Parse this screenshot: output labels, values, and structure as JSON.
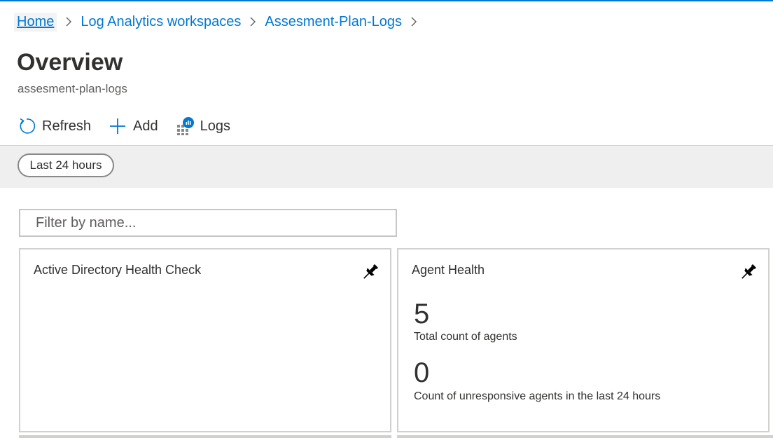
{
  "breadcrumb": {
    "items": [
      "Home",
      "Log Analytics workspaces",
      "Assesment-Plan-Logs"
    ]
  },
  "page": {
    "title": "Overview",
    "subtitle": "assesment-plan-logs"
  },
  "toolbar": {
    "refresh_label": "Refresh",
    "add_label": "Add",
    "logs_label": "Logs"
  },
  "time_filter": {
    "label": "Last 24 hours"
  },
  "filter": {
    "placeholder": "Filter by name..."
  },
  "tiles": {
    "ad_health": {
      "title": "Active Directory Health Check"
    },
    "agent_health": {
      "title": "Agent Health",
      "total_count": "5",
      "total_label": "Total count of agents",
      "unresponsive_count": "0",
      "unresponsive_label": "Count of unresponsive agents in the last 24 hours"
    }
  },
  "colors": {
    "accent": "#0078d4",
    "text": "#323130",
    "band": "#efefef"
  }
}
